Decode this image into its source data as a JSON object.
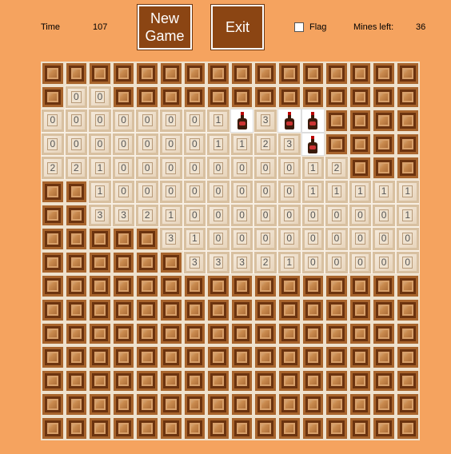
{
  "header": {
    "time_label": "Time",
    "time_value": "107",
    "new_game_label": "New\nGame",
    "exit_label": "Exit",
    "flag_label": "Flag",
    "mines_left_label": "Mines left:",
    "mines_left_value": "36"
  },
  "board": {
    "cols": 16,
    "rows": [
      "################",
      "#00#############",
      "00000001F3FF####",
      "0000000112 3F####",
      "2210000000012####",
      "##10000000011111#",
      "##332100000000011",
      "#####31000000000",
      "######3332100000",
      "################",
      "################",
      "################",
      "################",
      "################",
      "################",
      "################"
    ]
  }
}
